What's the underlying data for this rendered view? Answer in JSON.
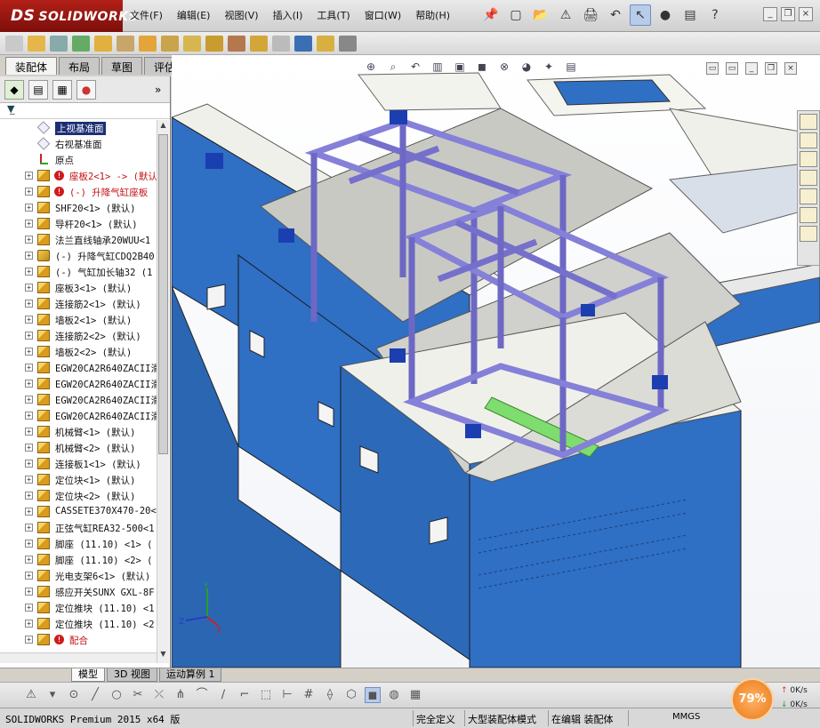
{
  "app": {
    "logo_text": "SOLIDWORKS",
    "logo_prefix": "DS"
  },
  "menu": [
    "文件(F)",
    "编辑(E)",
    "视图(V)",
    "插入(I)",
    "工具(T)",
    "窗口(W)",
    "帮助(H)"
  ],
  "window_controls": [
    "minimize-icon",
    "restore-icon",
    "close-icon"
  ],
  "command_tabs": [
    "装配体",
    "布局",
    "草图",
    "评估"
  ],
  "active_command_tab": "装配体",
  "feature_tree": {
    "nodes": [
      {
        "label": "上视基准面",
        "icon": "plane-icon",
        "expandable": false,
        "highlight": true
      },
      {
        "label": "右视基准面",
        "icon": "plane-icon",
        "expandable": false
      },
      {
        "label": "原点",
        "icon": "origin-icon",
        "expandable": false
      },
      {
        "label": "座板2<1> -> (默认",
        "icon": "part-icon",
        "expandable": true,
        "error": true,
        "red": true
      },
      {
        "label": "(-) 升降气缸座板",
        "icon": "part-icon",
        "expandable": true,
        "error": true,
        "red": true
      },
      {
        "label": "SHF20<1> (默认)",
        "icon": "part-icon",
        "expandable": true
      },
      {
        "label": "导杆20<1> (默认)",
        "icon": "part-icon",
        "expandable": true
      },
      {
        "label": "法兰直线轴承20WUU<1",
        "icon": "part-icon",
        "expandable": true
      },
      {
        "label": "(-) 升降气缸CDQ2B40",
        "icon": "asm-icon",
        "expandable": true
      },
      {
        "label": "(-) 气缸加长轴32 (1",
        "icon": "part-icon",
        "expandable": true
      },
      {
        "label": "座板3<1> (默认)",
        "icon": "part-icon",
        "expandable": true
      },
      {
        "label": "连接筋2<1> (默认)",
        "icon": "part-icon",
        "expandable": true
      },
      {
        "label": "墙板2<1> (默认)",
        "icon": "part-icon",
        "expandable": true
      },
      {
        "label": "连接筋2<2> (默认)",
        "icon": "part-icon",
        "expandable": true
      },
      {
        "label": "墙板2<2> (默认)",
        "icon": "part-icon",
        "expandable": true
      },
      {
        "label": "EGW20CA2R640ZACII滑",
        "icon": "part-icon",
        "expandable": true
      },
      {
        "label": "EGW20CA2R640ZACII滑",
        "icon": "part-icon",
        "expandable": true
      },
      {
        "label": "EGW20CA2R640ZACII滑",
        "icon": "part-icon",
        "expandable": true
      },
      {
        "label": "EGW20CA2R640ZACII滑",
        "icon": "part-icon",
        "expandable": true
      },
      {
        "label": "机械臂<1> (默认)",
        "icon": "part-icon",
        "expandable": true
      },
      {
        "label": "机械臂<2> (默认)",
        "icon": "part-icon",
        "expandable": true
      },
      {
        "label": "连接板1<1> (默认)",
        "icon": "part-icon",
        "expandable": true
      },
      {
        "label": "定位块<1> (默认)",
        "icon": "part-icon",
        "expandable": true
      },
      {
        "label": "定位块<2> (默认)",
        "icon": "part-icon",
        "expandable": true
      },
      {
        "label": "CASSETE370X470-20<1",
        "icon": "part-icon",
        "expandable": true
      },
      {
        "label": "正弦气缸REA32-500<1",
        "icon": "part-icon",
        "expandable": true
      },
      {
        "label": "脚座 (11.10) <1> (",
        "icon": "part-icon",
        "expandable": true
      },
      {
        "label": "脚座 (11.10) <2> (",
        "icon": "part-icon",
        "expandable": true
      },
      {
        "label": "光电支架6<1> (默认)",
        "icon": "part-icon",
        "expandable": true
      },
      {
        "label": "感应开关SUNX GXL-8F",
        "icon": "part-icon",
        "expandable": true
      },
      {
        "label": "定位推块 (11.10) <1",
        "icon": "part-icon",
        "expandable": true
      },
      {
        "label": "定位推块 (11.10) <2",
        "icon": "part-icon",
        "expandable": true
      },
      {
        "label": "配合",
        "icon": "mate-icon",
        "expandable": true,
        "error": true,
        "red": true
      }
    ]
  },
  "bottom_tabs": [
    "模型",
    "3D 视图",
    "运动算例 1"
  ],
  "active_bottom_tab": "模型",
  "status": {
    "product": "SOLIDWORKS Premium 2015 x64 版",
    "definition": "完全定义",
    "mode": "大型装配体模式",
    "editing": "在编辑 装配体",
    "units": "MMGS"
  },
  "net_meter": {
    "percent": "79%",
    "up": "0K/s",
    "down": "0K/s"
  },
  "colors": {
    "cabinet_blue": "#2f6fc4",
    "frame_purple": "#7a74cf",
    "logo_red": "#a81b14",
    "highlight_navy": "#1c2f74"
  }
}
